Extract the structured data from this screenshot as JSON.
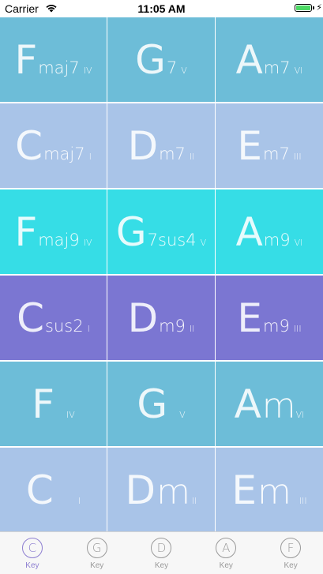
{
  "status_bar": {
    "carrier": "Carrier",
    "time": "11:05 AM"
  },
  "colors": {
    "blue": "#71bcd7",
    "lavender": "#a9c4e8",
    "cyan": "#35dbe4",
    "purple": "#7b76d2",
    "tab_active": "#8e7fd1",
    "tab_inactive": "#9a9a9a"
  },
  "chord_rows": [
    {
      "color": "#6dbdd8",
      "cells": [
        {
          "root": "F",
          "quality": "maj7",
          "numeral": "IV"
        },
        {
          "root": "G",
          "quality": "7",
          "numeral": "V"
        },
        {
          "root": "A",
          "quality": "m7",
          "numeral": "VI"
        }
      ]
    },
    {
      "color": "#a9c4e8",
      "cells": [
        {
          "root": "C",
          "quality": "maj7",
          "numeral": "I"
        },
        {
          "root": "D",
          "quality": "m7",
          "numeral": "II"
        },
        {
          "root": "E",
          "quality": "m7",
          "numeral": "III"
        }
      ]
    },
    {
      "color": "#36dde6",
      "cells": [
        {
          "root": "F",
          "quality": "maj9",
          "numeral": "IV"
        },
        {
          "root": "G",
          "quality": "7sus4",
          "numeral": "V"
        },
        {
          "root": "A",
          "quality": "m9",
          "numeral": "VI"
        }
      ]
    },
    {
      "color": "#7b76d2",
      "cells": [
        {
          "root": "C",
          "quality": "sus2",
          "numeral": "I"
        },
        {
          "root": "D",
          "quality": "m9",
          "numeral": "II"
        },
        {
          "root": "E",
          "quality": "m9",
          "numeral": "III"
        }
      ]
    },
    {
      "color": "#6dbdd8",
      "cells": [
        {
          "root": "F",
          "quality": "",
          "numeral": "IV"
        },
        {
          "root": "G",
          "quality": "",
          "numeral": "V"
        },
        {
          "root": "A",
          "quality": "m",
          "numeral": "VI"
        }
      ]
    },
    {
      "color": "#a9c4e8",
      "cells": [
        {
          "root": "C",
          "quality": "",
          "numeral": "I"
        },
        {
          "root": "D",
          "quality": "m",
          "numeral": "II"
        },
        {
          "root": "E",
          "quality": "m",
          "numeral": "III"
        }
      ]
    }
  ],
  "tabs": [
    {
      "icon_letter": "C",
      "label": "Key",
      "active": true,
      "icon": "key-c-icon"
    },
    {
      "icon_letter": "G",
      "label": "Key",
      "active": false,
      "icon": "key-g-icon"
    },
    {
      "icon_letter": "D",
      "label": "Key",
      "active": false,
      "icon": "key-d-icon"
    },
    {
      "icon_letter": "A",
      "label": "Key",
      "active": false,
      "icon": "key-a-icon"
    },
    {
      "icon_letter": "F",
      "label": "Key",
      "active": false,
      "icon": "key-f-icon"
    }
  ]
}
